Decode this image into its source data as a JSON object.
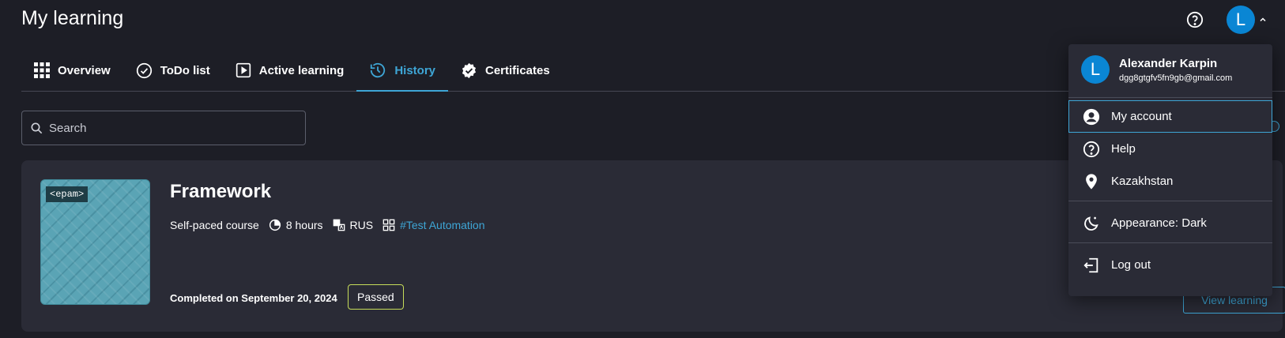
{
  "header": {
    "title": "My learning",
    "help_icon": "help-circle-icon",
    "avatar_initial": "L"
  },
  "tabs": [
    {
      "label": "Overview",
      "icon": "grid-icon"
    },
    {
      "label": "ToDo list",
      "icon": "check-circle-icon"
    },
    {
      "label": "Active learning",
      "icon": "play-square-icon"
    },
    {
      "label": "History",
      "icon": "history-icon",
      "active": true
    },
    {
      "label": "Certificates",
      "icon": "badge-check-icon"
    }
  ],
  "search": {
    "placeholder": "Search",
    "value": ""
  },
  "course": {
    "thumbnail_logo": "<epam>",
    "title": "Framework",
    "type": "Self-paced course",
    "duration": "8 hours",
    "language": "RUS",
    "tag": "#Test Automation",
    "completed_text": "Completed on September 20, 2024",
    "status": "Passed",
    "view_button": "View learning"
  },
  "user_menu": {
    "avatar_initial": "L",
    "name": "Alexander Karpin",
    "email": "dgg8gtgfv5fn9gb@gmail.com",
    "items": [
      {
        "label": "My account",
        "icon": "user-circle-icon"
      },
      {
        "label": "Help",
        "icon": "help-circle-icon"
      },
      {
        "label": "Kazakhstan",
        "icon": "map-pin-icon"
      },
      {
        "label": "Appearance: Dark",
        "icon": "moon-icon"
      },
      {
        "label": "Log out",
        "icon": "logout-icon"
      }
    ]
  },
  "colors": {
    "background": "#1d1e26",
    "surface": "#2a2b36",
    "accent": "#3ea6d6",
    "avatar": "#0a86d4",
    "passed_border": "#c6dc5a"
  }
}
